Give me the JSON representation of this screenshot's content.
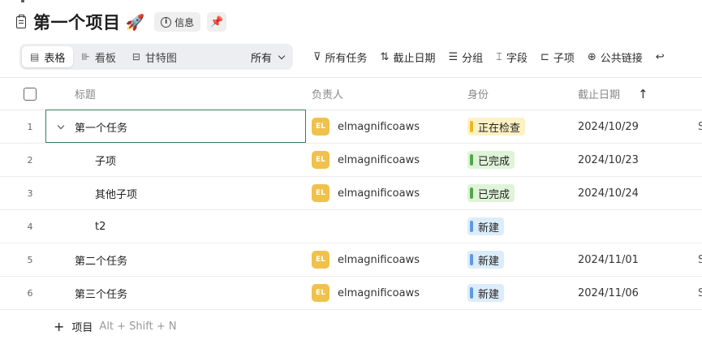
{
  "header": {
    "title": "第一个项目",
    "title_emoji": "🚀",
    "info_label": "信息",
    "doc_icon": "clipboard-icon",
    "pin_icon": "pin-icon"
  },
  "views": {
    "tabs": [
      {
        "label": "表格",
        "icon": "table-icon",
        "active": true
      },
      {
        "label": "看板",
        "icon": "kanban-icon",
        "active": false
      },
      {
        "label": "甘特图",
        "icon": "gantt-icon",
        "active": false
      }
    ],
    "filter_label": "所有"
  },
  "toolbar": {
    "filter": "所有任务",
    "sort": "截止日期",
    "group": "分组",
    "fields": "字段",
    "subitems": "子项",
    "public_link": "公共链接"
  },
  "table": {
    "columns": {
      "title": "标题",
      "owner": "负责人",
      "status": "身份",
      "due": "截止日期"
    },
    "rows": [
      {
        "num": "1",
        "title": "第一个任务",
        "owner_initials": "EL",
        "owner": "elmagnificoaws",
        "status": "正在检查",
        "due": "2024/10/29",
        "extra": "S"
      },
      {
        "num": "2",
        "title": "子项",
        "owner_initials": "EL",
        "owner": "elmagnificoaws",
        "status": "已完成",
        "due": "2024/10/23",
        "extra": ""
      },
      {
        "num": "3",
        "title": "其他子项",
        "owner_initials": "EL",
        "owner": "elmagnificoaws",
        "status": "已完成",
        "due": "2024/10/24",
        "extra": ""
      },
      {
        "num": "4",
        "title": "t2",
        "owner_initials": "",
        "owner": "",
        "status": "新建",
        "due": "",
        "extra": ""
      },
      {
        "num": "5",
        "title": "第二个任务",
        "owner_initials": "EL",
        "owner": "elmagnificoaws",
        "status": "新建",
        "due": "2024/11/01",
        "extra": "S"
      },
      {
        "num": "6",
        "title": "第三个任务",
        "owner_initials": "EL",
        "owner": "elmagnificoaws",
        "status": "新建",
        "due": "2024/11/06",
        "extra": "S"
      }
    ]
  },
  "add_item": {
    "label": "项目",
    "shortcut": "Alt + Shift + N"
  },
  "colors": {
    "accent_focus": "#3a7d5e",
    "avatar": "#f0c14b",
    "status_reviewing_bg": "#fdf1c4",
    "status_reviewing_bar": "#e8b923",
    "status_done_bg": "#dff3d8",
    "status_done_bar": "#4fa84a",
    "status_new_bg": "#dcecfa",
    "status_new_bar": "#5b9be0"
  }
}
